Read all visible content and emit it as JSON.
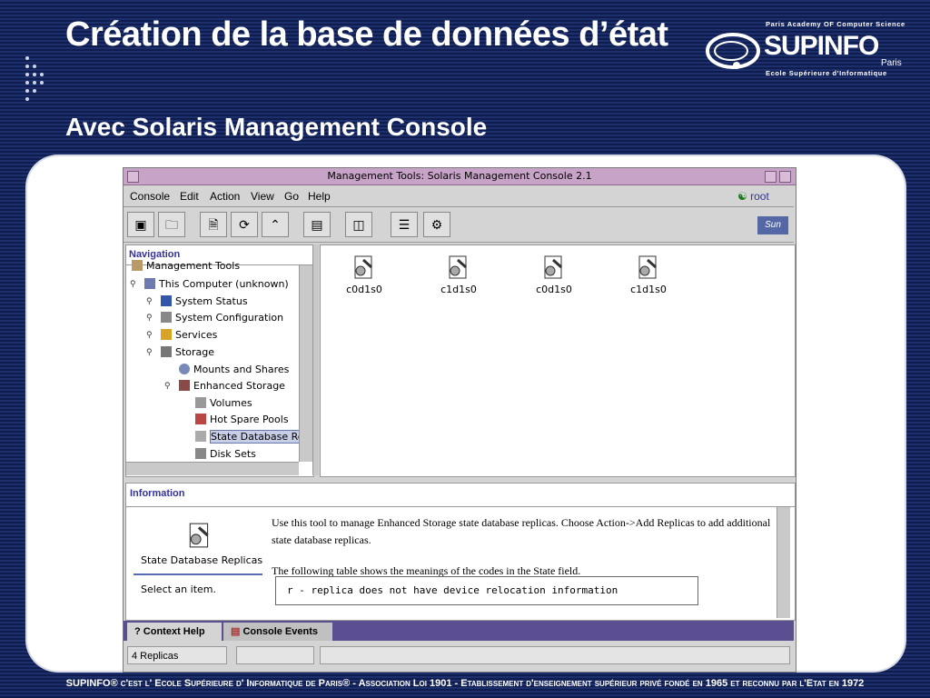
{
  "slide": {
    "title": "Création de la base de données d’état",
    "subtitle": "Avec Solaris Management Console",
    "footer": "SUPINFO® c'est l' Ecole Supérieure d' Informatique de Paris® - Association Loi 1901 - Etablissement d'enseignement supérieur privé fondé en 1965 et reconnu par l'Etat en 1972"
  },
  "logo": {
    "academy": "Paris Academy OF Computer Science",
    "brand": "SUPINFO",
    "city": "Paris",
    "school": "Ecole Supérieure d'Informatique"
  },
  "window": {
    "title": "Management Tools: Solaris Management Console 2.1",
    "user": "root",
    "sun_logo": "Sun"
  },
  "menu": {
    "console": "Console",
    "edit": "Edit",
    "action": "Action",
    "view": "View",
    "go": "Go",
    "help": "Help"
  },
  "navigation": {
    "header": "Navigation",
    "items": [
      {
        "label": "Management Tools",
        "icon": "toolbox-icon"
      },
      {
        "label": "This Computer (unknown)",
        "icon": "computer-icon"
      },
      {
        "label": "System Status",
        "icon": "bar-chart-icon"
      },
      {
        "label": "System Configuration",
        "icon": "configuration-icon"
      },
      {
        "label": "Services",
        "icon": "gears-icon"
      },
      {
        "label": "Storage",
        "icon": "storage-icon"
      },
      {
        "label": "Mounts and Shares",
        "icon": "mount-icon"
      },
      {
        "label": "Enhanced Storage",
        "icon": "enhanced-storage-icon"
      },
      {
        "label": "Volumes",
        "icon": "volumes-icon"
      },
      {
        "label": "Hot Spare Pools",
        "icon": "hot-spare-icon"
      },
      {
        "label": "State Database Re",
        "icon": "state-database-icon"
      },
      {
        "label": "Disk Sets",
        "icon": "disk-sets-icon"
      }
    ]
  },
  "content": {
    "items": [
      {
        "label": "c0d1s0"
      },
      {
        "label": "c1d1s0"
      },
      {
        "label": "c0d1s0"
      },
      {
        "label": "c1d1s0"
      }
    ]
  },
  "information": {
    "header": "Information",
    "tool_name": "State Database Replicas",
    "select_prompt": "Select an item.",
    "paragraph1": "Use this tool to manage Enhanced Storage state database replicas. Choose Action->Add Replicas to add additional state database replicas.",
    "paragraph2": "The following table shows the meanings of the codes in the State field.",
    "code_line": "r - replica does not have device relocation information"
  },
  "tabs": {
    "context_help": "Context Help",
    "console_events": "Console Events"
  },
  "status": {
    "count": "4 Replicas"
  },
  "colors": {
    "titlebar": "#c7a4c7",
    "tabbar": "#5b4f92",
    "heading": "#333399",
    "selection": "#c7cde6"
  }
}
